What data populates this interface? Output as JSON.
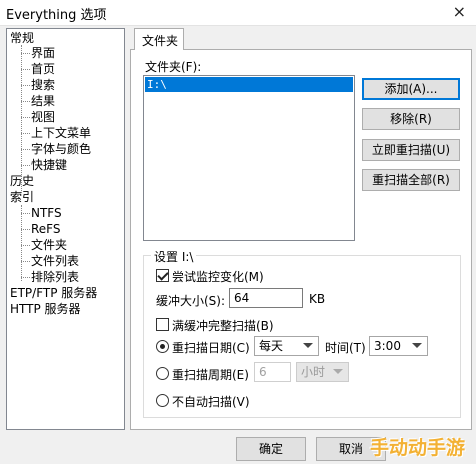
{
  "window": {
    "title": "Everything 选项",
    "close_glyph": "×"
  },
  "tree": {
    "items": [
      {
        "label": "常规"
      },
      {
        "label": "界面"
      },
      {
        "label": "首页"
      },
      {
        "label": "搜索"
      },
      {
        "label": "结果"
      },
      {
        "label": "视图"
      },
      {
        "label": "上下文菜单"
      },
      {
        "label": "字体与颜色"
      },
      {
        "label": "快捷键"
      },
      {
        "label": "历史"
      },
      {
        "label": "索引"
      },
      {
        "label": "NTFS"
      },
      {
        "label": "ReFS"
      },
      {
        "label": "文件夹"
      },
      {
        "label": "文件列表"
      },
      {
        "label": "排除列表"
      },
      {
        "label": "ETP/FTP 服务器"
      },
      {
        "label": "HTTP 服务器"
      }
    ]
  },
  "tab": {
    "label": "文件夹"
  },
  "folders": {
    "label": "文件夹(F):",
    "items": [
      "I:\\"
    ]
  },
  "buttons": {
    "add": "添加(A)...",
    "remove": "移除(R)",
    "rescan_now": "立即重扫描(U)",
    "rescan_all": "重扫描全部(R)",
    "ok": "确定",
    "cancel": "取消"
  },
  "settings": {
    "group_title": "设置 I:\\",
    "monitor_label": "尝试监控变化(M)",
    "monitor_checked": true,
    "buffer_label": "缓冲大小(S):",
    "buffer_value": "64",
    "buffer_unit": "KB",
    "full_rescan_label": "满缓冲完整扫描(B)",
    "full_rescan_checked": false,
    "rescan_date_label": "重扫描日期(C)",
    "rescan_date_value": "每天",
    "time_label": "时间(T)",
    "time_value": "3:00",
    "rescan_period_label": "重扫描周期(E)",
    "period_value": "6",
    "period_unit": "小时",
    "no_auto_label": "不自动扫描(V)",
    "selected_mode": "date"
  },
  "watermark": {
    "text": "手动动手游"
  }
}
